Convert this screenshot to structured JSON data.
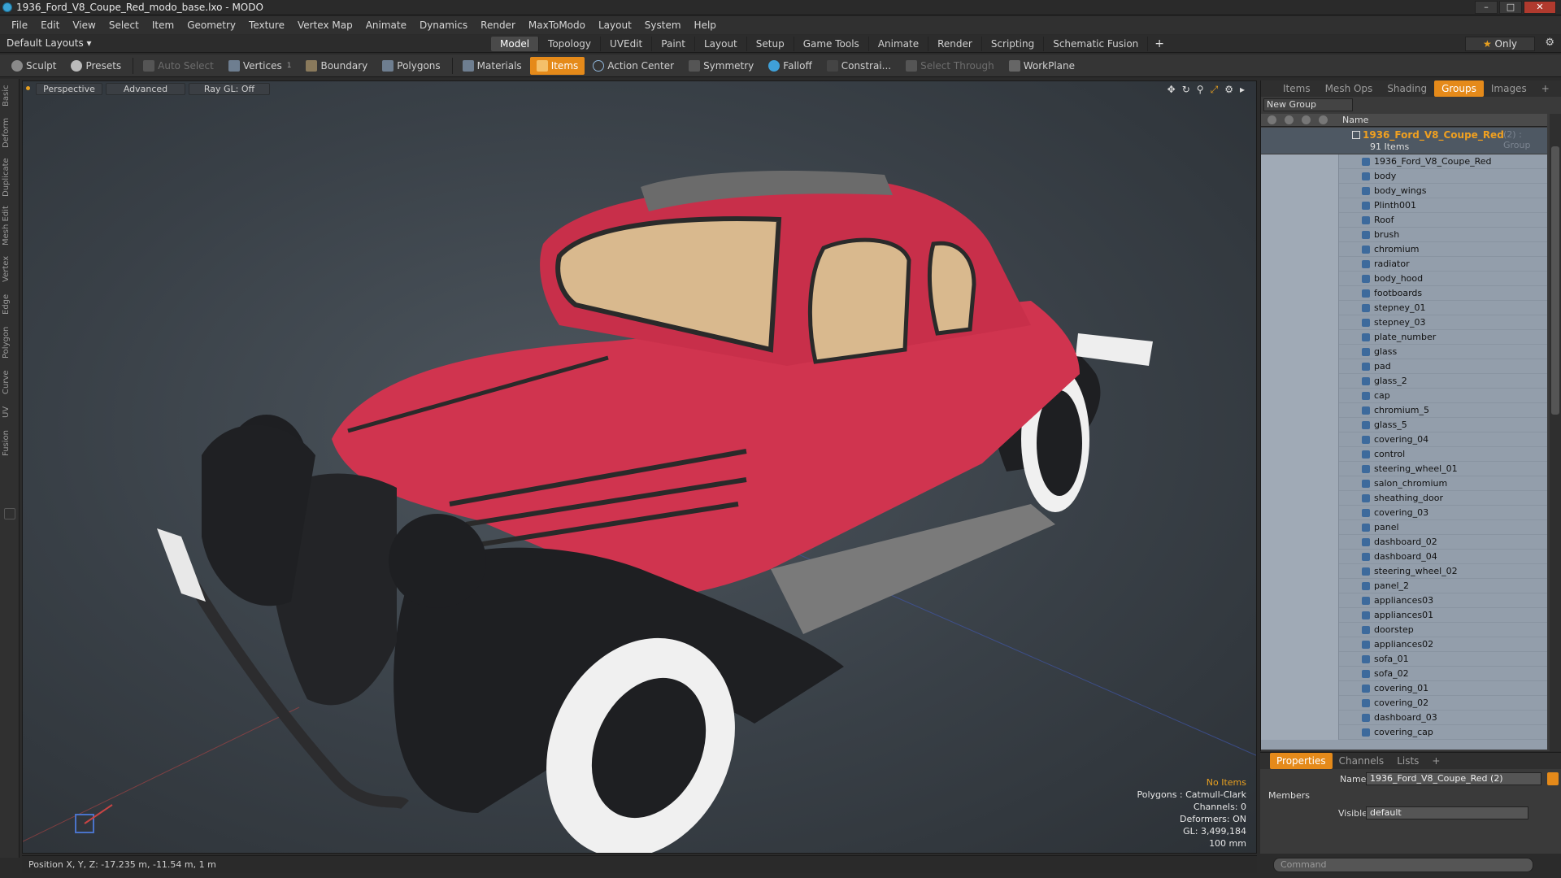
{
  "window": {
    "title": "1936_Ford_V8_Coupe_Red_modo_base.lxo - MODO"
  },
  "menu": [
    "File",
    "Edit",
    "View",
    "Select",
    "Item",
    "Geometry",
    "Texture",
    "Vertex Map",
    "Animate",
    "Dynamics",
    "Render",
    "MaxToModo",
    "Layout",
    "System",
    "Help"
  ],
  "layoutbar": {
    "layouts": "Default Layouts ▾",
    "tabs": [
      "Model",
      "Topology",
      "UVEdit",
      "Paint",
      "Layout",
      "Setup",
      "Game Tools",
      "Animate",
      "Render",
      "Scripting",
      "Schematic Fusion"
    ],
    "active_tab": "Model",
    "only": "Only"
  },
  "toolbar": {
    "sculpt": "Sculpt",
    "presets": "Presets",
    "auto_select": "Auto Select",
    "vertices": "Vertices",
    "vertices_badge": "1",
    "boundary": "Boundary",
    "polygons": "Polygons",
    "materials": "Materials",
    "items": "Items",
    "action_center": "Action Center",
    "symmetry": "Symmetry",
    "falloff": "Falloff",
    "constrain": "Constrai...",
    "select_through": "Select Through",
    "workplane": "WorkPlane"
  },
  "left_tabs": [
    "Basic",
    "Deform",
    "Duplicate",
    "Mesh Edit",
    "Vertex",
    "Edge",
    "Polygon",
    "Curve",
    "UV",
    "Fusion"
  ],
  "viewport": {
    "perspective": "Perspective",
    "advanced": "Advanced",
    "raygl": "Ray GL: Off",
    "info": {
      "no_items": "No Items",
      "polygons": "Polygons : Catmull-Clark",
      "channels": "Channels: 0",
      "deformers": "Deformers: ON",
      "gl": "GL: 3,499,184",
      "scale": "100 mm"
    },
    "colors": {
      "body": "#d0344f",
      "fender": "#1e1f22",
      "tire_wall": "#f2f2f2"
    }
  },
  "status": {
    "position": "Position X, Y, Z:  -17.235 m, -11.54 m, 1 m"
  },
  "panel": {
    "tabs": [
      "Items",
      "Mesh Ops",
      "Shading",
      "Groups",
      "Images"
    ],
    "active_tab": "Groups",
    "new_group": "New Group",
    "name_col": "Name",
    "group": {
      "name": "1936_Ford_V8_Coupe_Red",
      "suffix": "(2) : Group",
      "count": "91 Items"
    },
    "items": [
      "1936_Ford_V8_Coupe_Red",
      "body",
      "body_wings",
      "Plinth001",
      "Roof",
      "brush",
      "chromium",
      "radiator",
      "body_hood",
      "footboards",
      "stepney_01",
      "stepney_03",
      "plate_number",
      "glass",
      "pad",
      "glass_2",
      "cap",
      "chromium_5",
      "glass_5",
      "covering_04",
      "control",
      "steering_wheel_01",
      "salon_chromium",
      "sheathing_door",
      "covering_03",
      "panel",
      "dashboard_02",
      "dashboard_04",
      "steering_wheel_02",
      "panel_2",
      "appliances03",
      "appliances01",
      "doorstep",
      "appliances02",
      "sofa_01",
      "sofa_02",
      "covering_01",
      "covering_02",
      "dashboard_03",
      "covering_cap"
    ]
  },
  "properties": {
    "tabs": [
      "Properties",
      "Channels",
      "Lists"
    ],
    "active_tab": "Properties",
    "name_label": "Name",
    "name_value": "1936_Ford_V8_Coupe_Red (2)",
    "members": "Members",
    "visible_label": "Visible",
    "visible_value": "default",
    "command_placeholder": "Command"
  }
}
